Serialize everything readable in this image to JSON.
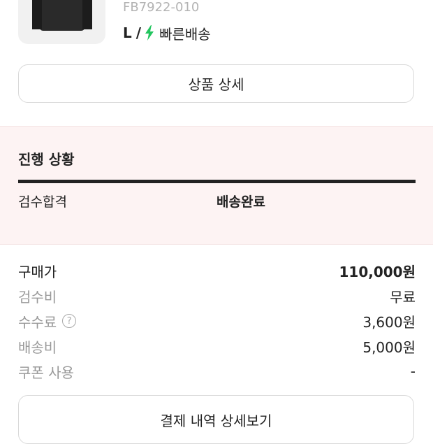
{
  "product": {
    "sku": "FB7922-010",
    "size": "L",
    "separator": "/",
    "shipping_label": "빠른배송",
    "shipping_icon": "lightning-bolt-icon",
    "accent_color": "#22c55e"
  },
  "detail_button_label": "상품 상세",
  "progress": {
    "title": "진행 상황",
    "steps": [
      "검수합격",
      "배송완료"
    ],
    "background": "#fdf3f3"
  },
  "payment": {
    "rows": [
      {
        "label": "구매가",
        "value": "110,000원"
      },
      {
        "label": "검수비",
        "value": "무료"
      },
      {
        "label": "수수료",
        "value": "3,600원"
      },
      {
        "label": "배송비",
        "value": "5,000원"
      },
      {
        "label": "쿠폰 사용",
        "value": "-"
      }
    ],
    "help_icon": "question-circle-icon",
    "help_glyph": "?"
  },
  "payment_detail_button_label": "결제 내역 상세보기"
}
